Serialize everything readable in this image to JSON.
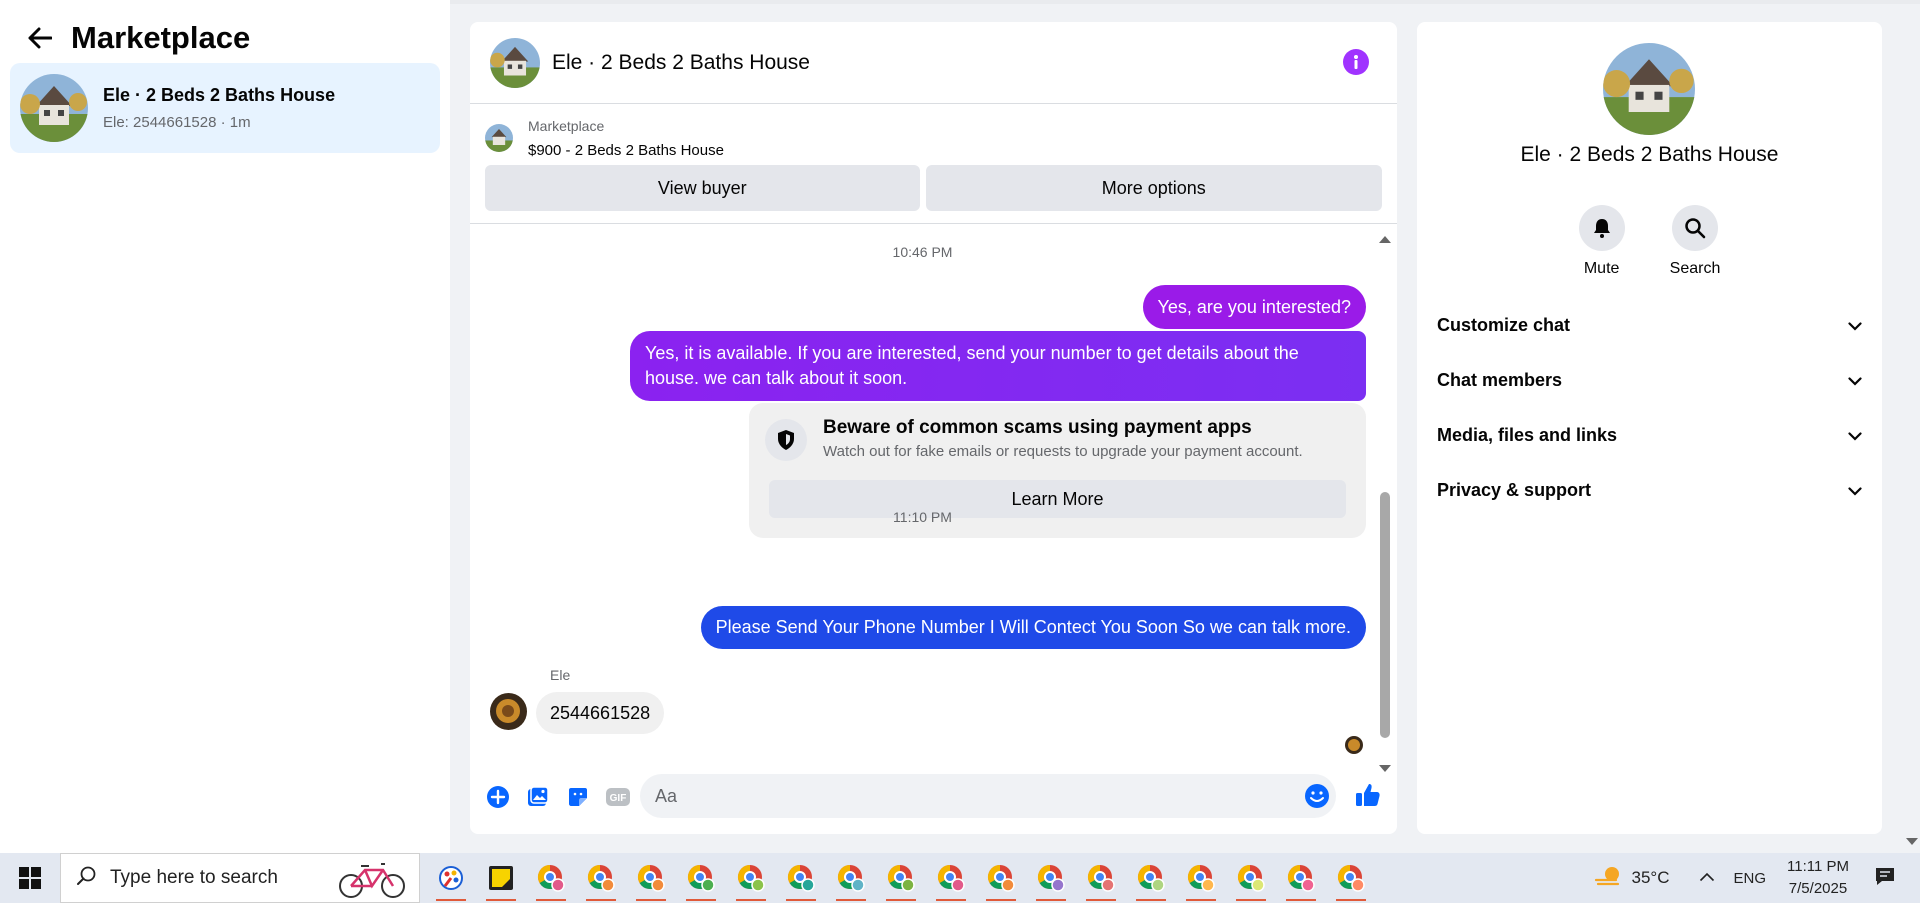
{
  "left_panel": {
    "title": "Marketplace",
    "conversation": {
      "title": "Ele · 2 Beds 2 Baths House",
      "subtitle": "Ele: 2544661528 · 1m"
    }
  },
  "chat": {
    "header_title": "Ele · 2 Beds 2 Baths House",
    "marketplace_label": "Marketplace",
    "listing": "$900 - 2 Beds 2 Baths House",
    "view_buyer_label": "View buyer",
    "more_options_label": "More options",
    "timestamp_1": "10:46 PM",
    "msg_1": "Yes, are you interested?",
    "msg_2": "Yes, it is available. If you are interested, send your number to get details about the house. we can talk about it soon.",
    "warning": {
      "title": "Beware of common scams using payment apps",
      "subtitle": "Watch out for fake emails or requests to upgrade your payment account.",
      "button": "Learn More"
    },
    "timestamp_2": "11:10 PM",
    "msg_3": "Please Send Your Phone Number I Will Contect You Soon So we can talk more.",
    "sender_name": "Ele",
    "received_msg": "2544661528",
    "composer_placeholder": "Aa",
    "gif_label": "GIF"
  },
  "right_panel": {
    "title": "Ele · 2 Beds 2 Baths House",
    "mute_label": "Mute",
    "search_label": "Search",
    "sections": [
      "Customize chat",
      "Chat members",
      "Media, files and links",
      "Privacy & support"
    ]
  },
  "taskbar": {
    "search_placeholder": "Type here to search",
    "weather": "35°C",
    "lang": "ENG",
    "time": "11:11 PM",
    "date": "7/5/2025"
  },
  "colors": {
    "accent_purple": "#9a1be8",
    "accent_blue": "#1f4ae8",
    "messenger_blue": "#0866ff"
  }
}
